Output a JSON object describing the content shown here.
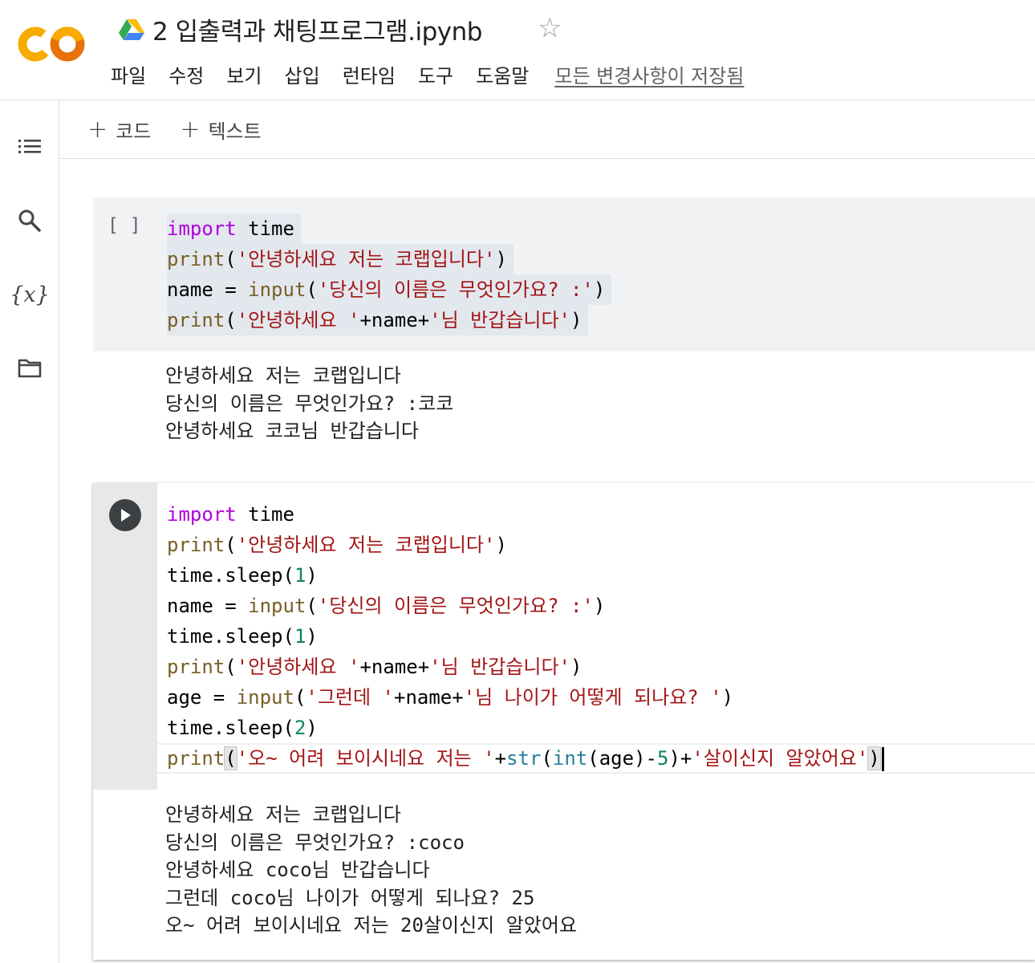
{
  "header": {
    "title": "2 입출력과 채팅프로그램.ipynb",
    "menu": [
      "파일",
      "수정",
      "보기",
      "삽입",
      "런타임",
      "도구",
      "도움말"
    ],
    "save_status": "모든 변경사항이 저장됨"
  },
  "icons": {
    "logo": "colab-logo",
    "drive": "google-drive-icon",
    "star": "star-icon",
    "rail": [
      "table-of-contents-icon",
      "search-icon",
      "variables-icon",
      "folder-icon"
    ]
  },
  "rail": {
    "vars_label": "{x}"
  },
  "toolbar": {
    "add_code": "코드",
    "add_text": "텍스트"
  },
  "cell1": {
    "exec_count": "[ ]",
    "code": [
      [
        [
          "kw",
          "import"
        ],
        [
          "pl",
          " time"
        ]
      ],
      [
        [
          "fn",
          "print"
        ],
        [
          "pl",
          "("
        ],
        [
          "str",
          "'안녕하세요 저는 코랩입니다'"
        ],
        [
          "pl",
          ")"
        ]
      ],
      [
        [
          "pl",
          "name = "
        ],
        [
          "fn",
          "input"
        ],
        [
          "pl",
          "("
        ],
        [
          "str",
          "'당신의 이름은 무엇인가요? :'"
        ],
        [
          "pl",
          ")"
        ]
      ],
      [
        [
          "fn",
          "print"
        ],
        [
          "pl",
          "("
        ],
        [
          "str",
          "'안녕하세요 '"
        ],
        [
          "pl",
          "+name+"
        ],
        [
          "str",
          "'님 반갑습니다'"
        ],
        [
          "pl",
          ")"
        ]
      ]
    ],
    "output": [
      "안녕하세요 저는 코랩입니다",
      "당신의 이름은 무엇인가요? :코코",
      "안녕하세요 코코님 반갑습니다"
    ]
  },
  "cell2": {
    "code": [
      [
        [
          "kw",
          "import"
        ],
        [
          "pl",
          " time"
        ]
      ],
      [
        [
          "fn",
          "print"
        ],
        [
          "pl",
          "("
        ],
        [
          "str",
          "'안녕하세요 저는 코랩입니다'"
        ],
        [
          "pl",
          ")"
        ]
      ],
      [
        [
          "pl",
          "time.sleep("
        ],
        [
          "num",
          "1"
        ],
        [
          "pl",
          ")"
        ]
      ],
      [
        [
          "pl",
          "name = "
        ],
        [
          "fn",
          "input"
        ],
        [
          "pl",
          "("
        ],
        [
          "str",
          "'당신의 이름은 무엇인가요? :'"
        ],
        [
          "pl",
          ")"
        ]
      ],
      [
        [
          "pl",
          "time.sleep("
        ],
        [
          "num",
          "1"
        ],
        [
          "pl",
          ")"
        ]
      ],
      [
        [
          "fn",
          "print"
        ],
        [
          "pl",
          "("
        ],
        [
          "str",
          "'안녕하세요 '"
        ],
        [
          "pl",
          "+name+"
        ],
        [
          "str",
          "'님 반갑습니다'"
        ],
        [
          "pl",
          ")"
        ]
      ],
      [
        [
          "pl",
          "age = "
        ],
        [
          "fn",
          "input"
        ],
        [
          "pl",
          "("
        ],
        [
          "str",
          "'그런데 '"
        ],
        [
          "pl",
          "+name+"
        ],
        [
          "str",
          "'님 나이가 어떻게 되나요? '"
        ],
        [
          "pl",
          ")"
        ]
      ],
      [
        [
          "pl",
          "time.sleep("
        ],
        [
          "num",
          "2"
        ],
        [
          "pl",
          ")"
        ]
      ],
      [
        [
          "fn",
          "print"
        ],
        [
          "pm",
          "("
        ],
        [
          "str",
          "'오~ 어려 보이시네요 저는 '"
        ],
        [
          "pl",
          "+"
        ],
        [
          "bi",
          "str"
        ],
        [
          "pl",
          "("
        ],
        [
          "bi",
          "int"
        ],
        [
          "pl",
          "(age)-"
        ],
        [
          "num",
          "5"
        ],
        [
          "pl",
          ")+"
        ],
        [
          "str",
          "'살이신지 알았어요'"
        ],
        [
          "pm",
          ")"
        ]
      ]
    ],
    "output": [
      "안녕하세요 저는 코랩입니다",
      "당신의 이름은 무엇인가요? :coco",
      "안녕하세요 coco님 반갑습니다",
      "그런데 coco님 나이가 어떻게 되나요? 25",
      "오~ 어려 보이시네요 저는 20살이신지 알았어요"
    ]
  },
  "colors": {
    "keyword": "#af00db",
    "function": "#795e26",
    "string": "#a31515",
    "number": "#098658",
    "builtin": "#267f99",
    "colab_orange": "#f9ab00",
    "colab_dark_orange": "#e8710a"
  }
}
